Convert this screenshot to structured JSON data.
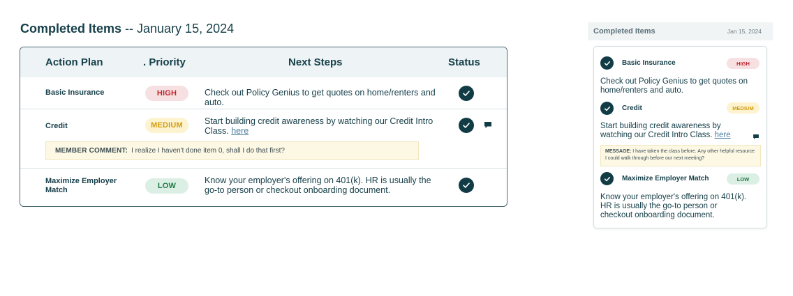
{
  "page": {
    "title_bold": "Completed Items",
    "title_rest": " -- January 15, 2024"
  },
  "table": {
    "headers": {
      "action_plan": "Action Plan",
      "priority": ". Priority",
      "next_steps": "Next Steps",
      "status": "Status"
    },
    "rows": [
      {
        "plan": "Basic Insurance",
        "priority": "HIGH",
        "steps": "Check out Policy Genius to get quotes on home/renters and auto.",
        "status": "completed"
      },
      {
        "plan": "Credit",
        "priority": "MEDIUM",
        "steps": "Start building credit awareness by watching our Credit Intro Class.",
        "link": "here",
        "status": "completed",
        "comment_label": "MEMBER COMMENT:",
        "comment_text": "I realize I haven't done item 0, shall I do that first?"
      },
      {
        "plan": "Maximize Employer Match",
        "priority": "LOW",
        "steps": "Know your employer's offering on 401(k). HR is usually the go-to person or checkout onboarding document.",
        "status": "completed"
      }
    ]
  },
  "mobile": {
    "title": "Completed Items",
    "date": "Jan 15, 2024",
    "items": [
      {
        "plan": "Basic Insurance",
        "priority": "HIGH",
        "steps": "Check out Policy Genius to get quotes on home/renters and auto."
      },
      {
        "plan": "Credit",
        "priority": "MEDIUM",
        "steps": "Start building credit awareness by watching our Credit Intro Class.",
        "link": "here",
        "message_label": "MESSAGE:",
        "message_text": "I have taken the class before. Any other helpful resource I could walk through before our next meeting?"
      },
      {
        "plan": "Maximize Employer Match",
        "priority": "LOW",
        "steps": "Know your employer's offering on 401(k). HR is usually the go-to person or checkout onboarding document."
      }
    ]
  },
  "icons": {
    "status": "check-circle-icon",
    "comment": "comment-icon"
  },
  "colors": {
    "dark": "#123c45",
    "high_bg": "#f7e0e1",
    "high_fg": "#c0232c",
    "medium_bg": "#fdf3cf",
    "medium_fg": "#d39c13",
    "low_bg": "#dcefe4",
    "low_fg": "#1f7a45",
    "comment_bg": "#fdf8e4"
  }
}
